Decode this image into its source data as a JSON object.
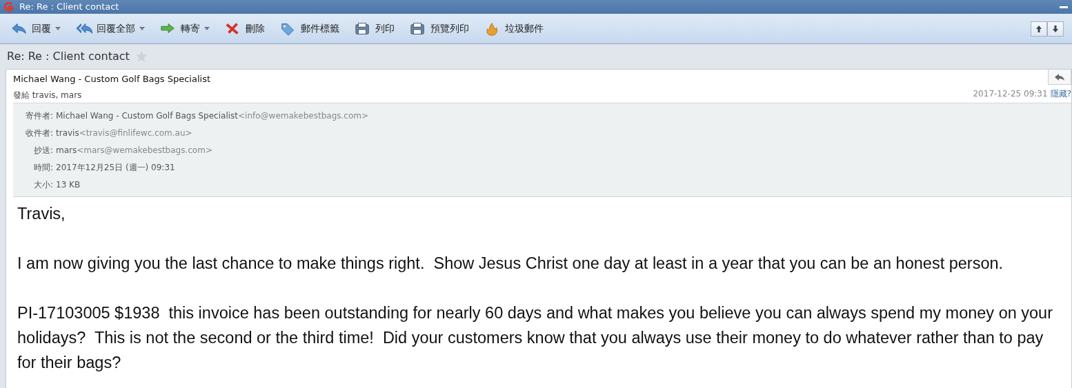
{
  "window": {
    "title": "Re: Re : Client contact"
  },
  "toolbar": [
    {
      "kind": "reply",
      "label": "回覆",
      "has_menu": true
    },
    {
      "kind": "reply-all",
      "label": "回覆全部",
      "has_menu": true
    },
    {
      "kind": "forward",
      "label": "轉寄",
      "has_menu": true
    },
    {
      "kind": "delete",
      "label": "刪除",
      "has_menu": false
    },
    {
      "kind": "tag",
      "label": "郵件標籤",
      "has_menu": false
    },
    {
      "kind": "print",
      "label": "列印",
      "has_menu": false
    },
    {
      "kind": "print",
      "label": "預覽列印",
      "has_menu": false
    },
    {
      "kind": "junk",
      "label": "垃圾郵件",
      "has_menu": false
    }
  ],
  "subject": {
    "text": "Re: Re : Client contact",
    "starred": false
  },
  "message": {
    "sender": "Michael Wang - Custom Golf Bags Specialist",
    "recipients_summary": "發給 travis, mars",
    "date": "2017-12-25 09:31",
    "toggle_link": "隱藏?",
    "details": [
      {
        "label": "寄件者:",
        "value": "Michael Wang - Custom Golf Bags Specialist",
        "address": "<info@wemakebestbags.com>"
      },
      {
        "label": "收件者:",
        "value": "travis",
        "address": "<travis@finlifewc.com.au>"
      },
      {
        "label": "抄送:",
        "value": "mars",
        "address": "<mars@wemakebestbags.com>"
      },
      {
        "label": "時間:",
        "value": "2017年12月25日 (週一) 09:31"
      },
      {
        "label": "大小:",
        "value": "13 KB"
      }
    ],
    "body": [
      "Travis,",
      "I am now giving you the last chance to make things right.  Show Jesus Christ one day at least in a year that you can be an honest person.",
      "PI-17103005 $1938  this invoice has been outstanding for nearly 60 days and what makes you believe you can always spend my money on your holidays?  This is not the second or the third time!  Did your customers know that you always use their money to do whatever rather than to pay for their bags?"
    ]
  }
}
